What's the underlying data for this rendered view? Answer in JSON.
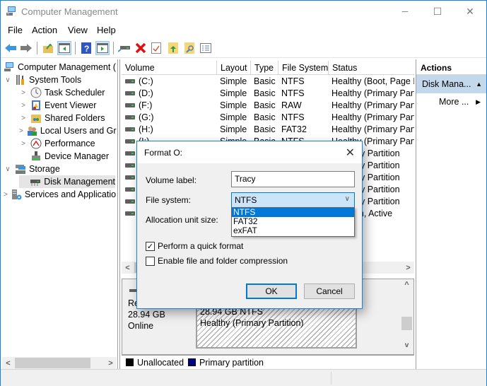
{
  "window": {
    "title": "Computer Management",
    "controls": {
      "minimize": "─",
      "maximize": "☐",
      "close": "✕"
    }
  },
  "menu": [
    "File",
    "Action",
    "View",
    "Help"
  ],
  "toolbar": {
    "buttons": [
      "back-icon",
      "forward-icon",
      "up-folder-icon",
      "show-hide-console-tree-icon",
      "help-icon",
      "show-hide-action-pane-icon",
      "connect-drive-icon",
      "delete-icon",
      "properties-icon",
      "export-icon",
      "search-icon",
      "list-icon"
    ]
  },
  "tree": {
    "items": [
      {
        "label": "Computer Management (Local)",
        "level": 0,
        "expander": ""
      },
      {
        "label": "System Tools",
        "level": 1,
        "expander": "∨"
      },
      {
        "label": "Task Scheduler",
        "level": 2,
        "expander": ">"
      },
      {
        "label": "Event Viewer",
        "level": 2,
        "expander": ">"
      },
      {
        "label": "Shared Folders",
        "level": 2,
        "expander": ">"
      },
      {
        "label": "Local Users and Groups",
        "level": 2,
        "expander": ">"
      },
      {
        "label": "Performance",
        "level": 2,
        "expander": ">"
      },
      {
        "label": "Device Manager",
        "level": 2,
        "expander": ""
      },
      {
        "label": "Storage",
        "level": 1,
        "expander": "∨"
      },
      {
        "label": "Disk Management",
        "level": 2,
        "expander": "",
        "selected": true
      },
      {
        "label": "Services and Applications",
        "level": 1,
        "expander": ">"
      }
    ]
  },
  "volume_table": {
    "columns": [
      "Volume",
      "Layout",
      "Type",
      "File System",
      "Status"
    ],
    "rows": [
      [
        "(C:)",
        "Simple",
        "Basic",
        "NTFS",
        "Healthy (Boot, Page File"
      ],
      [
        "(D:)",
        "Simple",
        "Basic",
        "NTFS",
        "Healthy (Primary Partition"
      ],
      [
        "(F:)",
        "Simple",
        "Basic",
        "RAW",
        "Healthy (Primary Partition"
      ],
      [
        "(G:)",
        "Simple",
        "Basic",
        "NTFS",
        "Healthy (Primary Partition"
      ],
      [
        "(H:)",
        "Simple",
        "Basic",
        "FAT32",
        "Healthy (Primary Partition"
      ],
      [
        "(I:)",
        "Simple",
        "Basic",
        "NTFS",
        "Healthy (Primary Partition"
      ],
      [
        "",
        "",
        "",
        "",
        "(Primary Partition"
      ],
      [
        "",
        "",
        "",
        "",
        "(Primary Partition"
      ],
      [
        "",
        "",
        "",
        "",
        "(Primary Partition"
      ],
      [
        "",
        "",
        "",
        "",
        "(Primary Partition"
      ],
      [
        "",
        "",
        "",
        "",
        "(Primary Partition"
      ],
      [
        "",
        "",
        "",
        "",
        "(System, Active"
      ]
    ]
  },
  "disk_graph": {
    "disk_label": "Re",
    "disk_size": "28.94 GB",
    "disk_state": "Online",
    "partition_size": "28.94 GB NTFS",
    "partition_status": "Healthy (Primary Partition)"
  },
  "legend": [
    {
      "label": "Unallocated",
      "color": "#000000"
    },
    {
      "label": "Primary partition",
      "color": "#000080"
    }
  ],
  "actions": {
    "header": "Actions",
    "section": "Disk Mana...",
    "more": "More ..."
  },
  "dialog": {
    "title": "Format O:",
    "volume_label_label": "Volume label:",
    "volume_label_value": "Tracy",
    "file_system_label": "File system:",
    "file_system_value": "NTFS",
    "file_system_options": [
      "NTFS",
      "FAT32",
      "exFAT"
    ],
    "allocation_label": "Allocation unit size:",
    "quick_format_label": "Perform a quick format",
    "quick_format_checked": true,
    "compression_label": "Enable file and folder compression",
    "compression_checked": false,
    "ok": "OK",
    "cancel": "Cancel"
  },
  "colors": {
    "accent": "#0078d7",
    "window_border": "#1883d7",
    "selection": "#cce4f7"
  }
}
